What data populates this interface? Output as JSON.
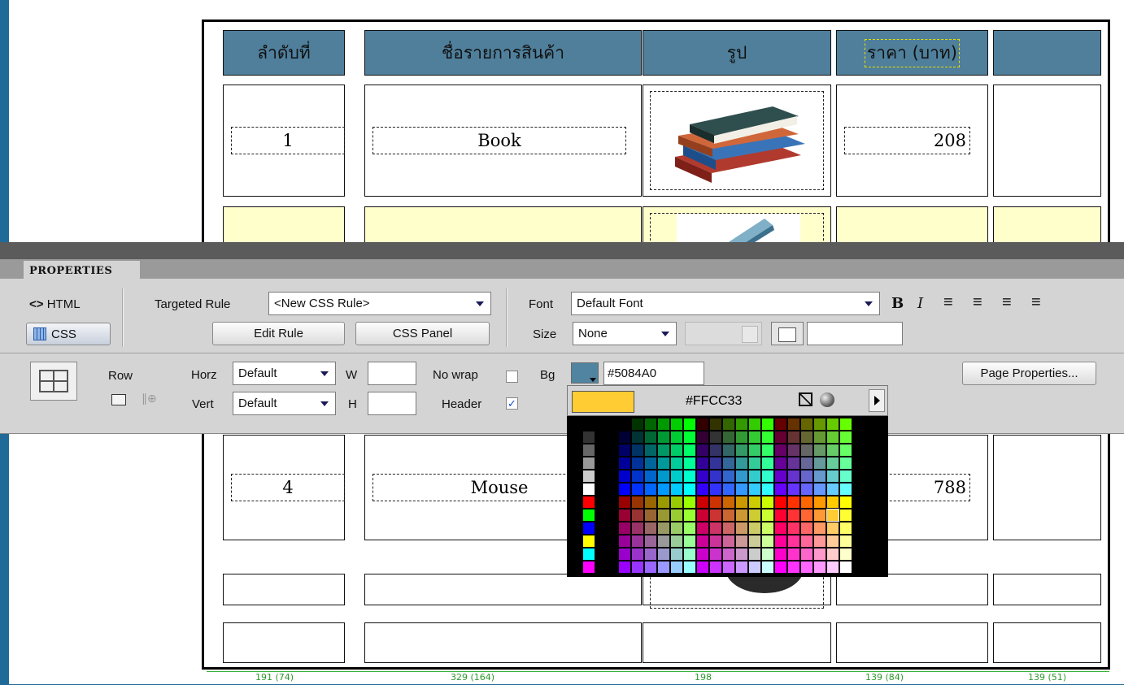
{
  "table": {
    "headers": [
      "ลำดับที่",
      "ชื่อรายการสินค้า",
      "รูป",
      "ราคา (บาท)",
      ""
    ],
    "rows": [
      {
        "no": "1",
        "name": "Book",
        "price": "208"
      },
      {
        "no": "4",
        "name": "Mouse",
        "price": "788"
      }
    ],
    "ruler": [
      "191 (74)",
      "329 (164)",
      "198",
      "139 (84)",
      "139 (51)"
    ]
  },
  "properties": {
    "tab_label": "PROPERTIES",
    "html_label": "HTML",
    "css_label": "CSS",
    "targeted_rule_label": "Targeted Rule",
    "targeted_rule_value": "<New CSS Rule>",
    "edit_rule_label": "Edit Rule",
    "css_panel_label": "CSS Panel",
    "font_label": "Font",
    "font_value": "Default Font",
    "size_label": "Size",
    "size_value": "None",
    "row_label": "Row",
    "horz_label": "Horz",
    "horz_value": "Default",
    "vert_label": "Vert",
    "vert_value": "Default",
    "w_label": "W",
    "h_label": "H",
    "nowrap_label": "No wrap",
    "header_label": "Header",
    "header_checked": true,
    "bg_label": "Bg",
    "bg_value": "#5084A0",
    "bg_color": "#5084A0",
    "page_properties_label": "Page Properties..."
  },
  "color_picker": {
    "hex_value": "#FFCC33",
    "swatch_color": "#FFCC33",
    "selected_color": "#FFCC33"
  },
  "colors": {
    "header_bg": "#4F7F9B",
    "alt_row_bg": "#FFFFCC",
    "panel_bg": "#D4D4D4"
  }
}
